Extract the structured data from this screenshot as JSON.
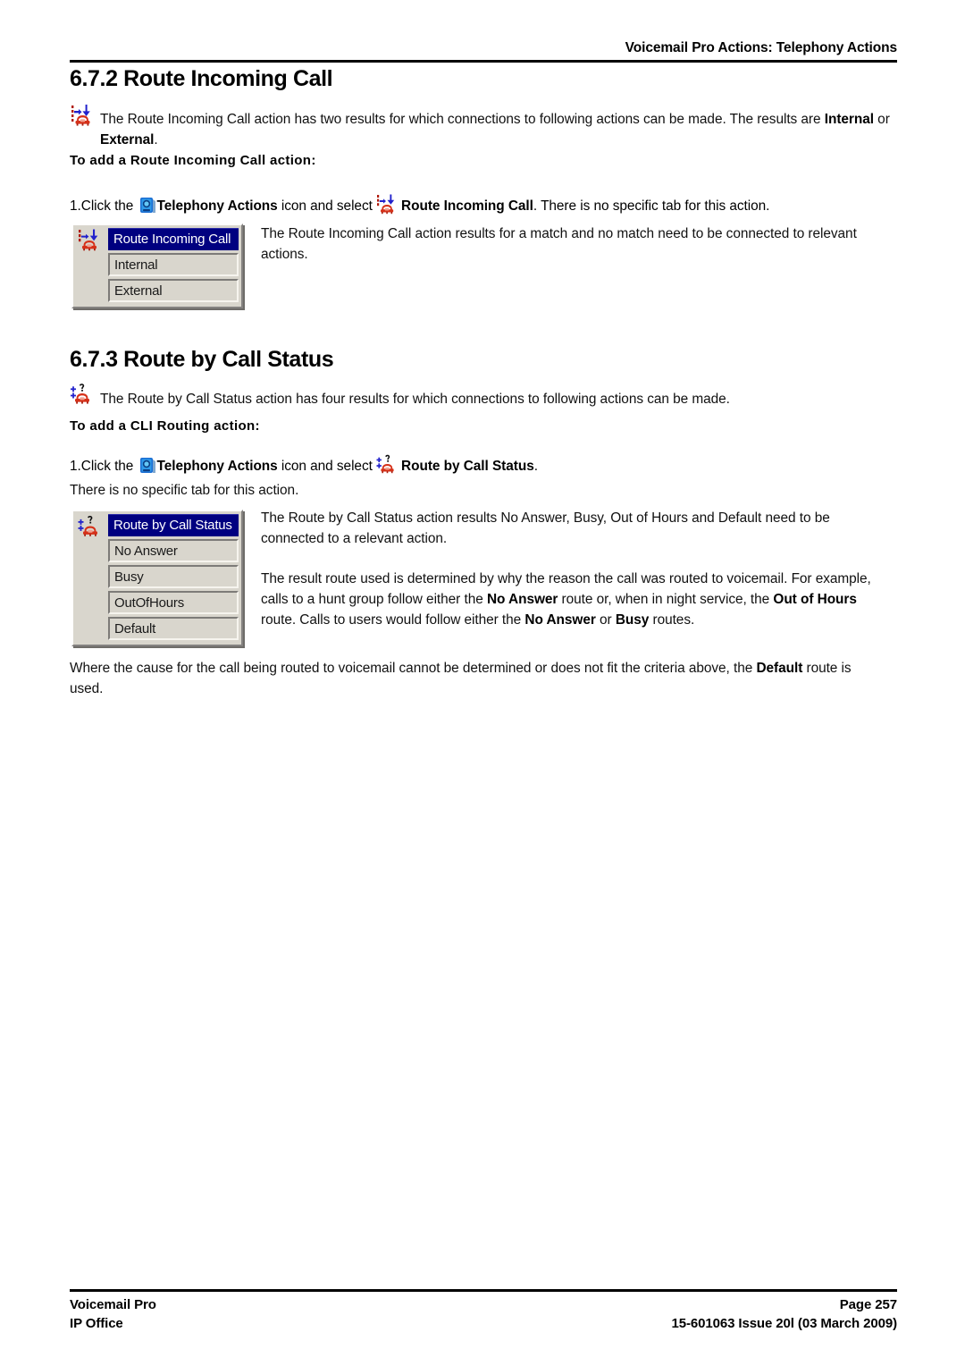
{
  "header": {
    "title": "Voicemail Pro Actions: Telephony Actions"
  },
  "sections": {
    "route_incoming_call": {
      "heading": "6.7.2 Route Incoming Call",
      "intro_part1": "The Route Incoming Call action has two results for which connections to following actions can be made. The results are ",
      "intro_bold1": "Internal",
      "intro_mid": " or ",
      "intro_bold2": "External",
      "intro_end": ".",
      "subhead": "To add a Route Incoming Call action:",
      "step_num": "1.",
      "step_pre": "Click the ",
      "step_bold1": "Telephony Actions",
      "step_mid": " icon and select ",
      "step_bold2": "Route Incoming Call",
      "step_end": ". There is no specific tab for this action.",
      "side_text": "The Route Incoming Call action results for a match and no match need to be connected to relevant actions.",
      "widget": {
        "title": "Route Incoming Call",
        "items": [
          "Internal",
          "External"
        ],
        "icon": "route-incoming-call-icon"
      }
    },
    "route_by_call_status": {
      "heading": "6.7.3 Route by Call Status",
      "intro": "The Route by Call Status action has four results for which connections to following actions can be made.",
      "subhead": "To add a CLI Routing action:",
      "step_num": "1.",
      "step_pre": "Click the ",
      "step_bold1": "Telephony Actions",
      "step_mid": " icon and select ",
      "step_bold2": "Route by Call Status",
      "step_end": ".",
      "no_tab_text": "There is no specific tab for this action.",
      "side_para1": "The Route by Call Status action results No Answer, Busy, Out of Hours and Default need to be connected to a relevant action.",
      "side_para2_a": "The result route used is determined by why the reason the call was routed to voicemail. For example, calls to a hunt group follow either the ",
      "side_para2_b1": "No Answer",
      "side_para2_c": " route or, when in night service, the ",
      "side_para2_b2": "Out of Hours",
      "side_para2_d": " route. Calls to users would follow either the ",
      "side_para2_b3": "No Answer",
      "side_para2_e": " or ",
      "side_para2_b4": "Busy",
      "side_para2_f": " routes.",
      "closing_a": "Where the cause for the call being routed to voicemail cannot be determined or does not fit the criteria above, the ",
      "closing_b": "Default",
      "closing_c": " route is used.",
      "widget": {
        "title": "Route by Call Status",
        "items": [
          "No Answer",
          "Busy",
          "OutOfHours",
          "Default"
        ],
        "icon": "route-by-call-status-icon"
      }
    }
  },
  "footer": {
    "left_line1": "Voicemail Pro",
    "left_line2": "IP Office",
    "right_line1": "Page 257",
    "right_line2": "15-601063 Issue 20l (03 March 2009)"
  },
  "colors": {
    "title_bar": "#000080",
    "widget_face": "#d9d6cd",
    "phone_red": "#d63018",
    "accent_blue": "#2222cc",
    "rule_black": "#000000"
  }
}
